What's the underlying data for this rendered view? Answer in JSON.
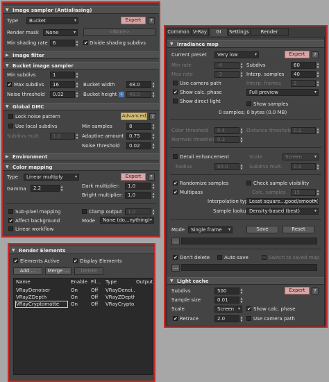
{
  "colors": {
    "frame_border": "#c42a2a",
    "panel_bg": "#444444",
    "expert_button": "#d9a7a7",
    "advanced_button": "#d8c07a",
    "lock_badge": "#4a7cc0"
  },
  "common": {
    "expert": "Expert",
    "advanced": "Advanced",
    "help": "?",
    "check": "✔",
    "tri_open": "▼",
    "tri_closed": "▶",
    "arrow": "▾",
    "spin_up": "▲",
    "spin_down": "▼",
    "dots": "...",
    "lock_badge": "L"
  },
  "left": {
    "image_sampler": {
      "title": "Image sampler (Antialiasing)",
      "type_label": "Type",
      "type_value": "Bucket",
      "render_mask_label": "Render mask",
      "render_mask_value": "None",
      "render_mask_object": "<None>",
      "min_shading_label": "Min shading rate",
      "min_shading_value": "6",
      "divide_shading": "Divide shading subdivs"
    },
    "image_filter": {
      "title": "Image filter"
    },
    "bucket": {
      "title": "Bucket image sampler",
      "min_subdivs_label": "Min subdivs",
      "min_subdivs_value": "1",
      "max_subdivs_label": "Max subdivs",
      "max_subdivs_value": "16",
      "noise_label": "Noise threshold",
      "noise_value": "0.02",
      "width_label": "Bucket width",
      "width_value": "48.0",
      "height_label": "Bucket height",
      "height_value": "48.0"
    },
    "global_dmc": {
      "title": "Global DMC",
      "lock_noise": "Lock noise pattern",
      "use_local": "Use local subdivs",
      "subdivs_mult_label": "Subdivs mult.",
      "subdivs_mult_value": "1.0",
      "min_samples_label": "Min samples",
      "min_samples_value": "8",
      "adaptive_label": "Adaptive amount",
      "adaptive_value": "0.75",
      "noise_label": "Noise threshold",
      "noise_value": "0.02"
    },
    "environment": {
      "title": "Environment"
    },
    "color_mapping": {
      "title": "Color mapping",
      "type_label": "Type",
      "type_value": "Linear multiply",
      "gamma_label": "Gamma",
      "gamma_value": "2.2",
      "dark_label": "Dark multiplier:",
      "dark_value": "1.0",
      "bright_label": "Bright multiplier:",
      "bright_value": "1.0",
      "subpixel": "Sub-pixel mapping",
      "clamp_output": "Clamp output",
      "clamp_value": "1.0",
      "affect_bg": "Affect background",
      "mode_label": "Mode",
      "mode_value": "None (do...nything)",
      "linear_workflow": "Linear workflow"
    }
  },
  "render_elements": {
    "title": "Render Elements",
    "elements_active": "Elements Active",
    "display_elements": "Display Elements",
    "add": "Add ...",
    "merge": "Merge ...",
    "delete": "Delete",
    "columns": [
      "Name",
      "Enable",
      "Fil...",
      "Type",
      "Output Path"
    ],
    "rows": [
      {
        "name": "VRayDenoiser",
        "enabled": "On",
        "filter": "Off",
        "type": "VRayDenoi..."
      },
      {
        "name": "VRayZDepth",
        "enabled": "On",
        "filter": "Off",
        "type": "VRayZDepth"
      },
      {
        "name": "VRayCryptomatte",
        "enabled": "On",
        "filter": "Off",
        "type": "VRayCrypto..."
      }
    ]
  },
  "right": {
    "tabs": [
      "Common",
      "V-Ray",
      "GI",
      "Settings",
      "Render Elements"
    ],
    "irradiance": {
      "title": "Irradiance map",
      "preset_label": "Current preset",
      "preset_value": "Very low",
      "min_rate_label": "Min rate",
      "min_rate_value": "-4",
      "max_rate_label": "Max rate",
      "max_rate_value": "-3",
      "subdivs_label": "Subdivs",
      "subdivs_value": "60",
      "interp_label": "Interp. samples",
      "interp_value": "40",
      "interp_frames_label": "Interp. frames",
      "interp_frames_value": "2",
      "use_camera_path": "Use camera path",
      "show_calc": "Show calc. phase",
      "show_direct": "Show direct light",
      "preview_value": "Full preview",
      "show_samples": "Show samples",
      "stats": "0 samples; 0 bytes (0.0 MB)",
      "color_thr_label": "Color threshold",
      "color_thr_value": "0.4",
      "normal_thr_label": "Normals threshold",
      "normal_thr_value": "0.3",
      "dist_thr_label": "Distance threshold",
      "dist_thr_value": "0.1",
      "detail": "Detail enhancement",
      "scale_label": "Scale",
      "scale_value": "Screen",
      "radius_label": "Radius",
      "radius_value": "60.0",
      "subdivs_mult_label": "Subdivs mult.",
      "subdivs_mult_value": "0.3",
      "randomize": "Randomize samples",
      "check_visibility": "Check sample visibility",
      "multipass": "Multipass",
      "calc_samples_label": "Calc. samples",
      "calc_samples_value": "15",
      "interp_type_label": "Interpolation type",
      "interp_type_value": "Least square...good/smooth)",
      "lookup_label": "Sample lookup",
      "lookup_value": "Density-based (best)",
      "mode_label": "Mode",
      "mode_value": "Single frame",
      "save": "Save",
      "reset": "Reset",
      "dont_delete": "Don't delete",
      "auto_save": "Auto save",
      "switch_saved": "Switch to saved map"
    },
    "light_cache": {
      "title": "Light cache",
      "subdivs_label": "Subdivs",
      "subdivs_value": "500",
      "sample_size_label": "Sample size",
      "sample_size_value": "0.01",
      "scale_label": "Scale",
      "scale_value": "Screen",
      "show_calc": "Show calc. phase",
      "retrace": "Retrace",
      "retrace_value": "2.0",
      "use_camera_path": "Use camera path"
    }
  }
}
